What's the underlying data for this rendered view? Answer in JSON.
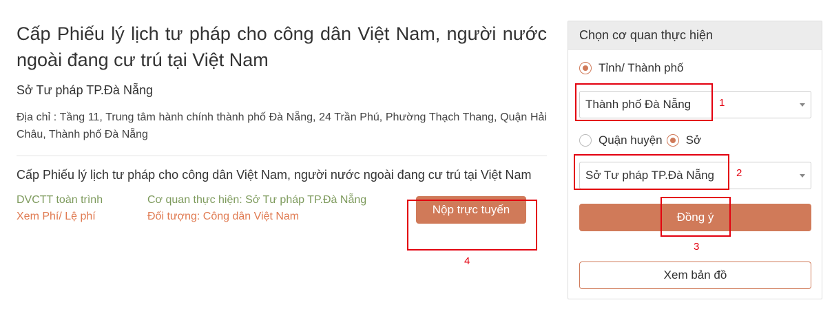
{
  "procedure": {
    "title": "Cấp Phiếu lý lịch tư pháp cho công dân Việt Nam, người nước ngoài đang cư trú tại Việt Nam",
    "agency": "Sở Tư pháp TP.Đà Nẵng",
    "address": "Địa chỉ : Tầng 11, Trung tâm hành chính thành phố Đà Nẵng, 24 Trần Phú, Phường Thạch Thang, Quận Hải Châu, Thành phố Đà Nẵng"
  },
  "service": {
    "title": "Cấp Phiếu lý lịch tư pháp cho công dân Việt Nam, người nước ngoài đang cư trú tại Việt Nam",
    "level_label": "DVCTT toàn trình",
    "fee_link": "Xem Phí/ Lệ phí",
    "executing_agency": "Cơ quan thực hiện: Sở Tư pháp TP.Đà Nẵng",
    "target": "Đối tượng: Công dân Việt Nam",
    "submit_button": "Nộp trực tuyến"
  },
  "panel": {
    "header": "Chọn cơ quan thực hiện",
    "province_radio_label": "Tỉnh/ Thành phố",
    "province_selected": "Thành phố Đà Nẵng",
    "district_radio_label": "Quận huyện",
    "department_radio_label": "Sở",
    "department_selected": "Sở Tư pháp TP.Đà Nẵng",
    "agree_button": "Đồng ý",
    "map_button": "Xem bản đồ"
  },
  "annotations": {
    "n1": "1",
    "n2": "2",
    "n3": "3",
    "n4": "4"
  },
  "colors": {
    "accent": "#d07a59",
    "annotation": "#e3000f",
    "green_text": "#7d9a5c",
    "orange_text": "#e07b52"
  }
}
